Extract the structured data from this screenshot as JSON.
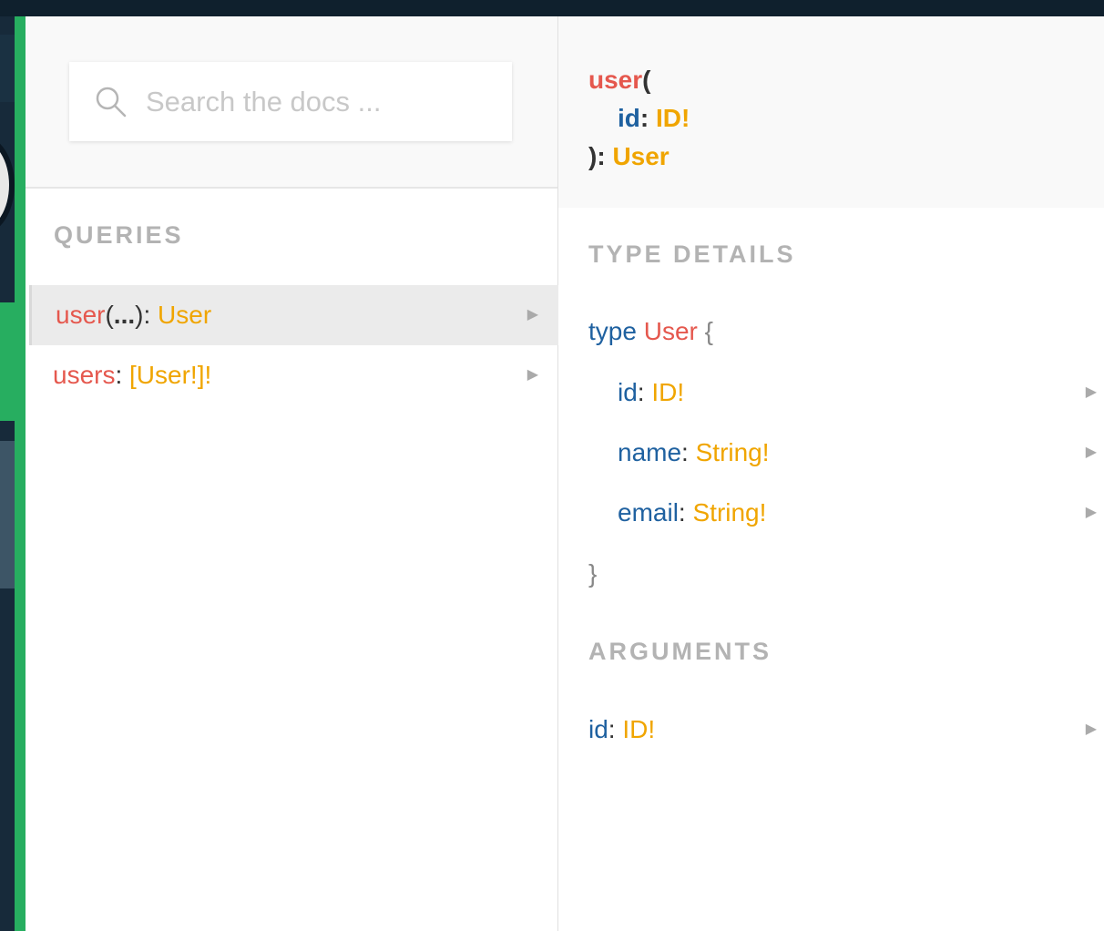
{
  "colors": {
    "field_name": "#e5584e",
    "type_name": "#f0a500",
    "arg_name": "#1f61a0",
    "section_title": "#b3b3b3",
    "green_bar": "#27ae60",
    "top_bar": "#0f202d"
  },
  "search": {
    "placeholder": "Search the docs ...",
    "icon": "search-icon"
  },
  "queries": {
    "title": "QUERIES",
    "items": [
      {
        "name": "user",
        "open": "(",
        "dots": "...",
        "close": ")",
        "sep": ": ",
        "type": "User",
        "arrow": "▶"
      },
      {
        "name": "users",
        "sep": ": ",
        "type": "[User!]!",
        "arrow": "▶"
      }
    ]
  },
  "signature": {
    "name": "user",
    "open": "(",
    "arg_name": "id",
    "arg_sep": ": ",
    "arg_type": "ID!",
    "close": "): ",
    "return_type": "User"
  },
  "type_details": {
    "title": "TYPE DETAILS",
    "keyword": "type",
    "type_name": "User",
    "open_brace": "{",
    "close_brace": "}",
    "fields": [
      {
        "name": "id",
        "sep": ": ",
        "type": "ID!",
        "arrow": "▶"
      },
      {
        "name": "name",
        "sep": ": ",
        "type": "String!",
        "arrow": "▶"
      },
      {
        "name": "email",
        "sep": ": ",
        "type": "String!",
        "arrow": "▶"
      }
    ]
  },
  "arguments": {
    "title": "ARGUMENTS",
    "items": [
      {
        "name": "id",
        "sep": ": ",
        "type": "ID!",
        "arrow": "▶"
      }
    ]
  }
}
